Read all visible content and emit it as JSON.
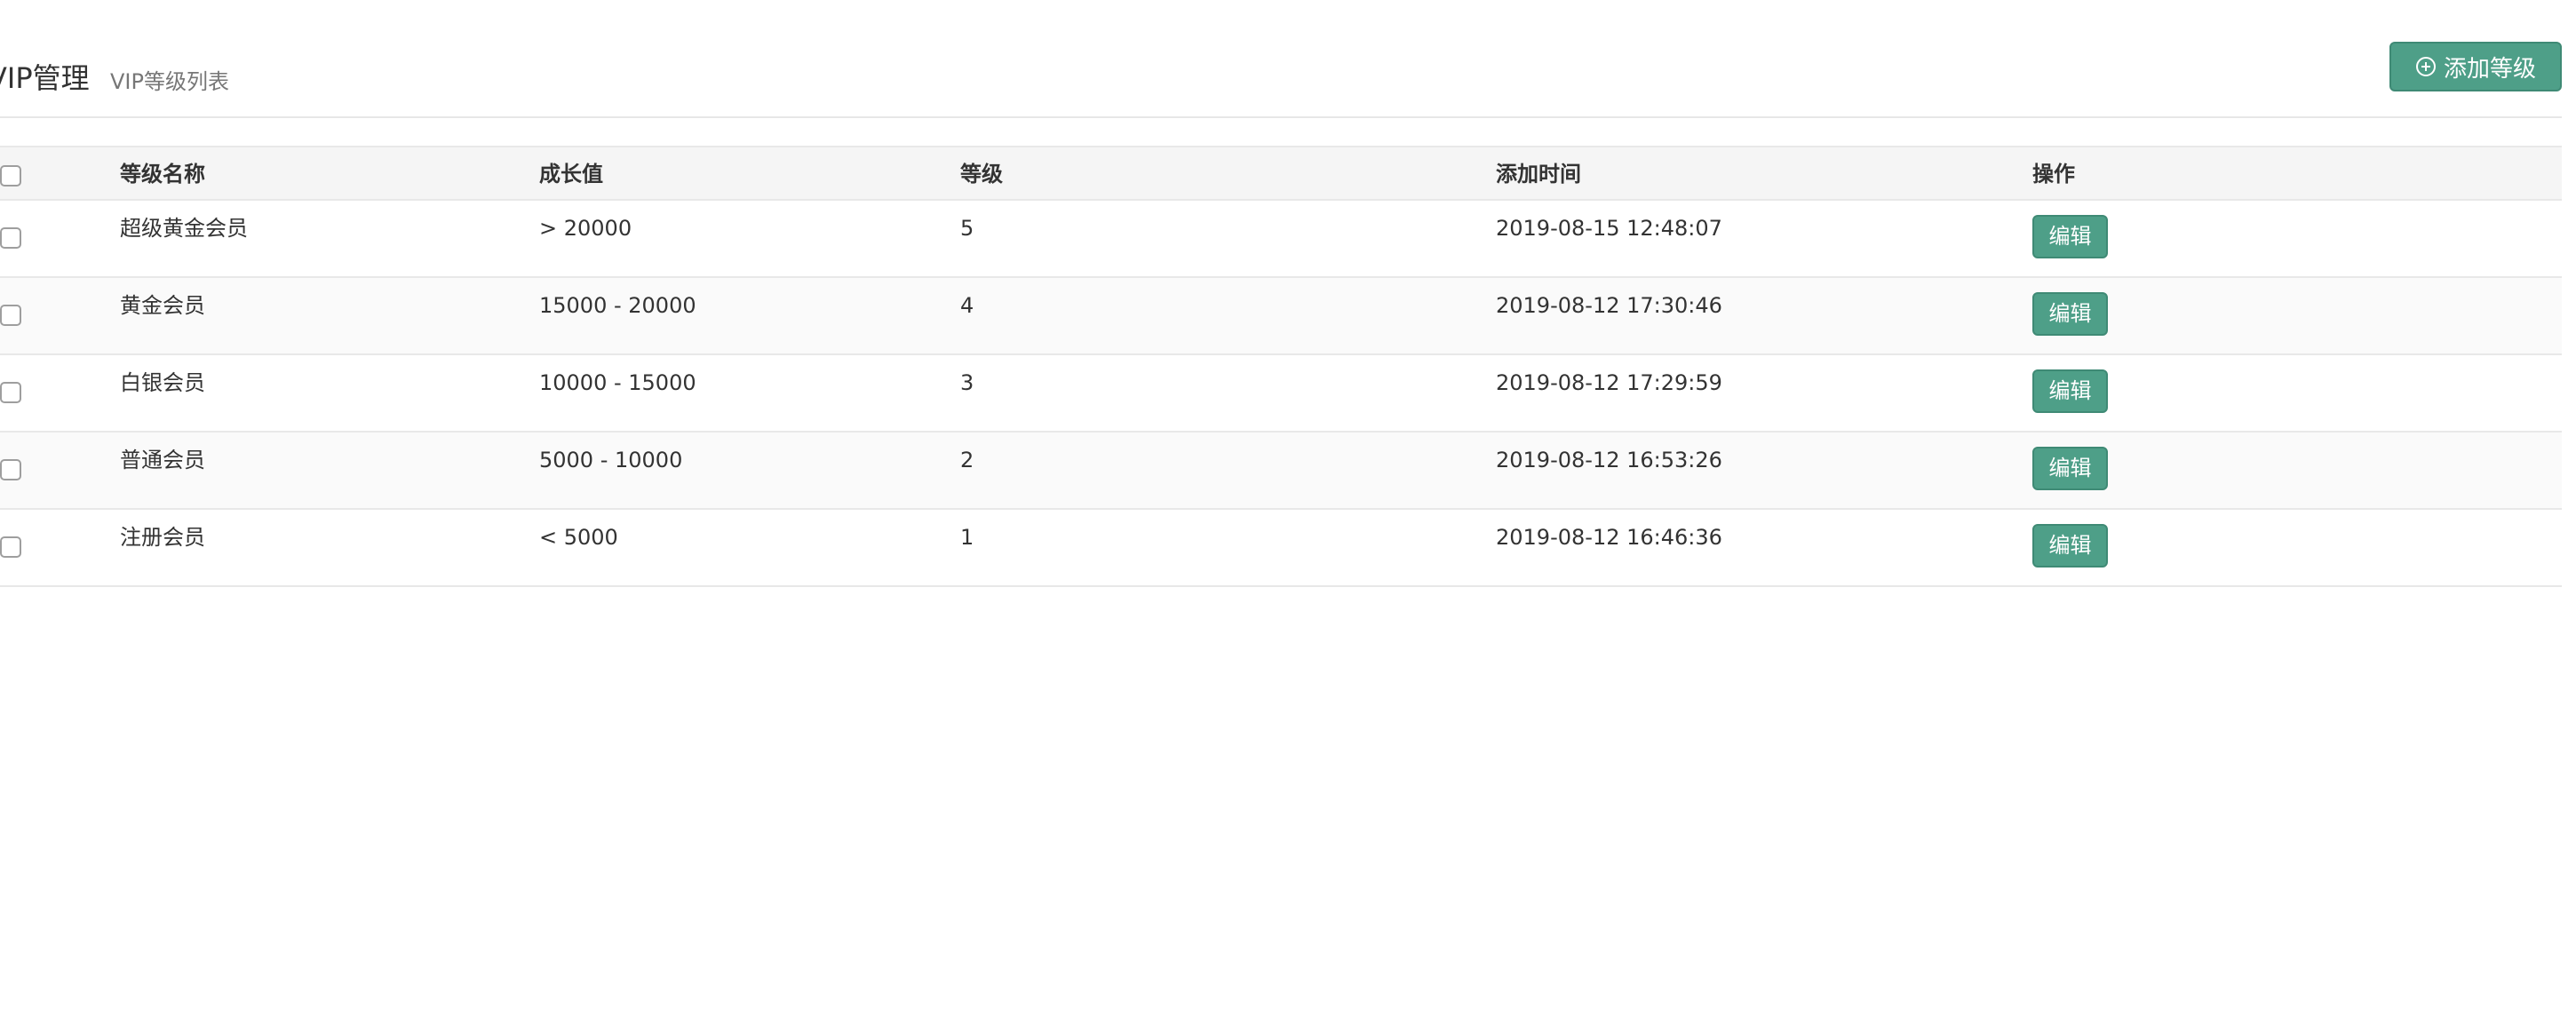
{
  "header": {
    "title": "VIP管理",
    "subtitle": "VIP等级列表",
    "add_button_label": "添加等级"
  },
  "table": {
    "columns": [
      "等级名称",
      "成长值",
      "等级",
      "添加时间",
      "操作"
    ],
    "rows": [
      {
        "name": "超级黄金会员",
        "growth": "> 20000",
        "level": "5",
        "added": "2019-08-15 12:48:07",
        "action": "编辑"
      },
      {
        "name": "黄金会员",
        "growth": "15000 - 20000",
        "level": "4",
        "added": "2019-08-12 17:30:46",
        "action": "编辑"
      },
      {
        "name": "白银会员",
        "growth": "10000 - 15000",
        "level": "3",
        "added": "2019-08-12 17:29:59",
        "action": "编辑"
      },
      {
        "name": "普通会员",
        "growth": "5000 - 10000",
        "level": "2",
        "added": "2019-08-12 16:53:26",
        "action": "编辑"
      },
      {
        "name": "注册会员",
        "growth": "< 5000",
        "level": "1",
        "added": "2019-08-12 16:46:36",
        "action": "编辑"
      }
    ]
  },
  "icons": {
    "add_button_icon": "plus-circle-icon"
  },
  "colors": {
    "accent": "#4e9f88",
    "accent_border": "#3f8a75",
    "header_row_bg": "#f5f5f5",
    "alt_row_bg": "#fafafa"
  }
}
